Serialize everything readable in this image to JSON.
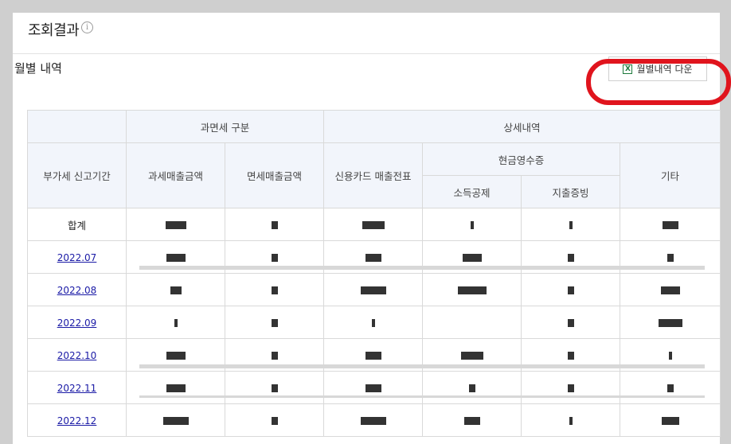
{
  "header": {
    "title": "조회결과",
    "info_icon": "info-icon"
  },
  "section": {
    "title": "월별 내역",
    "download_label": "월별내역 다운",
    "download_icon": "excel-icon"
  },
  "table": {
    "h_period": "부가세 신고기간",
    "h_tax_group": "과면세 구분",
    "h_taxable": "과세매출금액",
    "h_exempt": "면세매출금액",
    "h_detail_group": "상세내역",
    "h_card": "신용카드 매출전표",
    "h_cash_group": "현금영수증",
    "h_income": "소득공제",
    "h_expense": "지출증빙",
    "h_etc": "기타",
    "rows": [
      {
        "period": "합계"
      },
      {
        "period": "2022.07"
      },
      {
        "period": "2022.08"
      },
      {
        "period": "2022.09"
      },
      {
        "period": "2022.10"
      },
      {
        "period": "2022.11"
      },
      {
        "period": "2022.12"
      }
    ]
  }
}
